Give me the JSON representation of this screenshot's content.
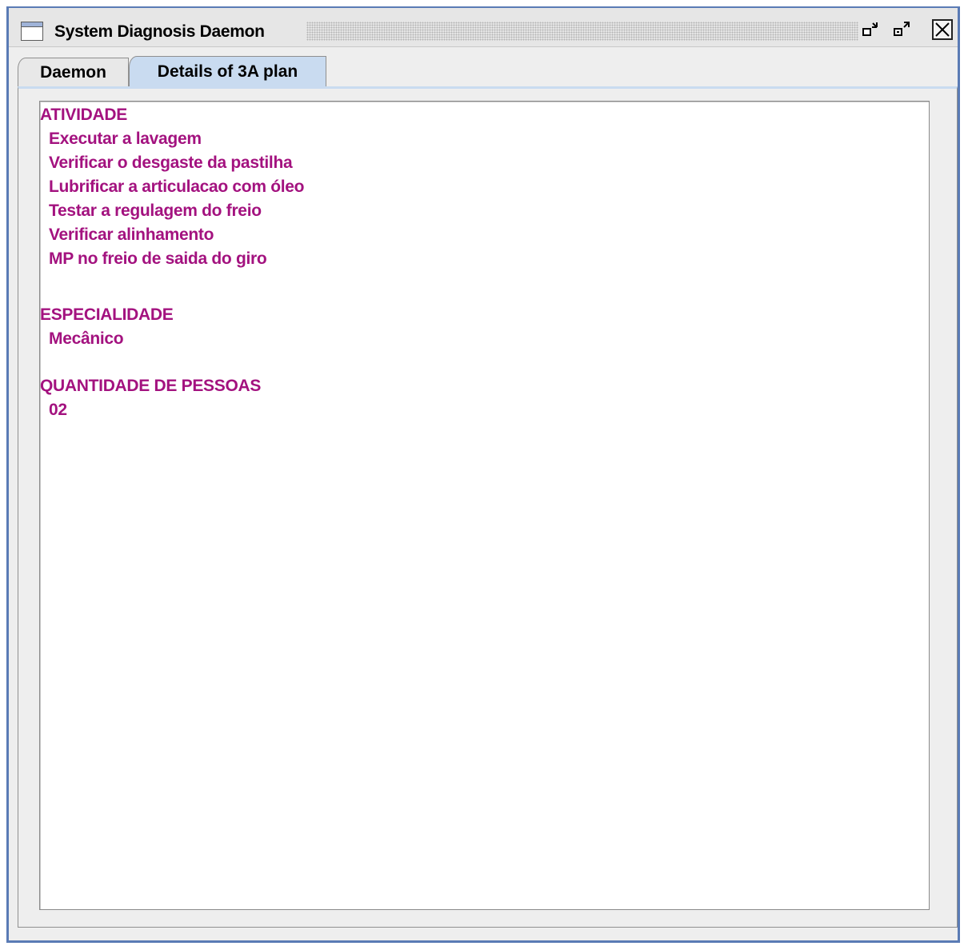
{
  "window": {
    "title": "System Diagnosis Daemon",
    "icons": {
      "app": "window-icon",
      "minimize": "minimize-icon",
      "maximize": "maximize-icon",
      "close": "close-icon"
    }
  },
  "tabs": [
    {
      "label": "Daemon",
      "selected": false
    },
    {
      "label": "Details of 3A plan",
      "selected": true
    }
  ],
  "details": {
    "text_color": "#a3127f",
    "atividade": {
      "heading": "ATIVIDADE",
      "items": [
        "Executar a lavagem",
        "Verificar o desgaste da pastilha",
        "Lubrificar a articulacao com óleo",
        "Testar a regulagem do freio",
        "Verificar alinhamento",
        "MP no freio de saida do giro"
      ]
    },
    "especialidade": {
      "heading": "ESPECIALIDADE",
      "value": "Mecânico"
    },
    "quantidade": {
      "heading": "QUANTIDADE DE PESSOAS",
      "value": "02"
    }
  }
}
